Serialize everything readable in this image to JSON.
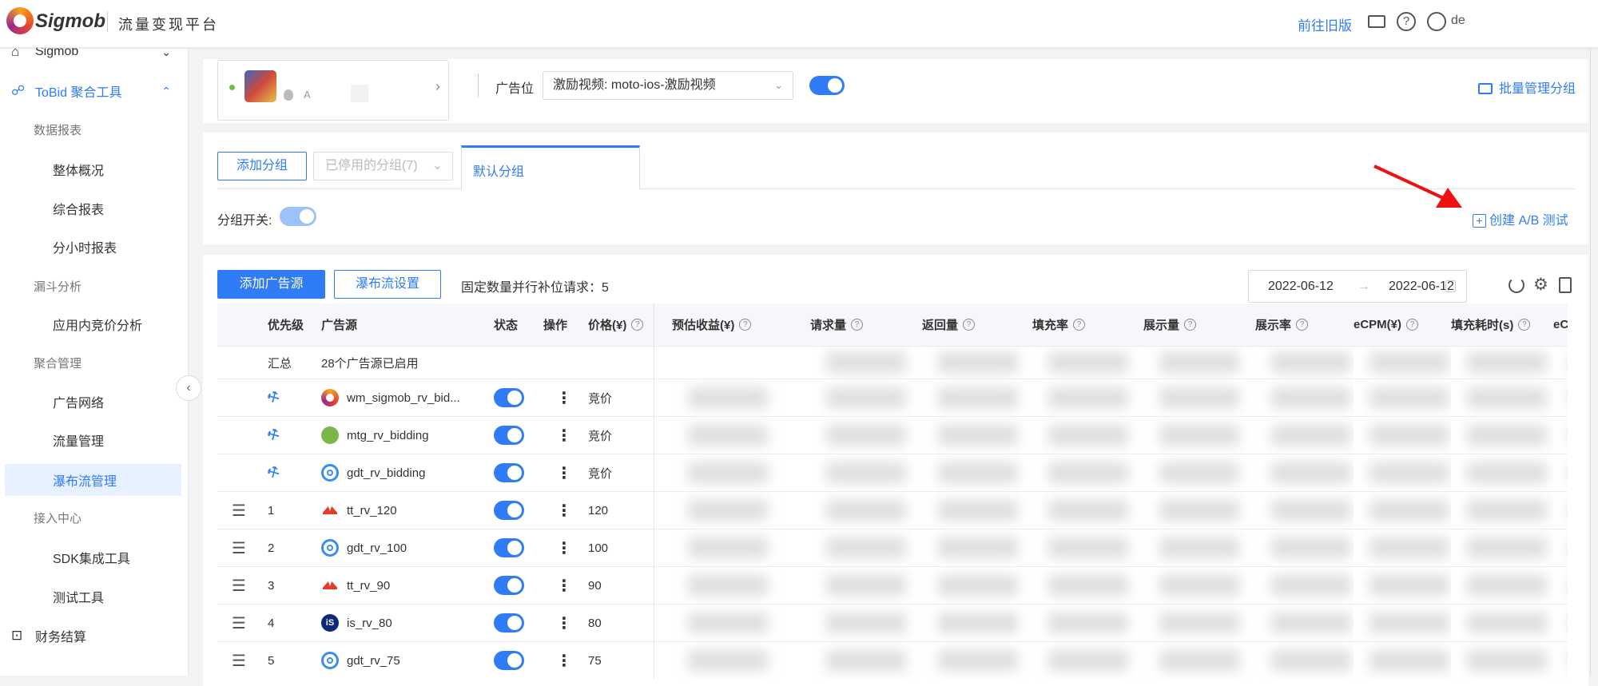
{
  "header": {
    "logo": "Sigmob",
    "platform": "流量变现平台",
    "old_version": "前往旧版",
    "user": "de"
  },
  "sidebar": {
    "items": [
      {
        "label": "Sigmob",
        "type": "l1"
      },
      {
        "label": "ToBid 聚合工具",
        "type": "l1"
      },
      {
        "label": "数据报表",
        "type": "grp"
      },
      {
        "label": "整体概况",
        "type": "l3"
      },
      {
        "label": "综合报表",
        "type": "l3"
      },
      {
        "label": "分小时报表",
        "type": "l3"
      },
      {
        "label": "漏斗分析",
        "type": "grp"
      },
      {
        "label": "应用内竞价分析",
        "type": "l3"
      },
      {
        "label": "聚合管理",
        "type": "grp"
      },
      {
        "label": "广告网络",
        "type": "l3"
      },
      {
        "label": "流量管理",
        "type": "l3"
      },
      {
        "label": "瀑布流管理",
        "type": "l3",
        "selected": true
      },
      {
        "label": "接入中心",
        "type": "grp"
      },
      {
        "label": "SDK集成工具",
        "type": "l3"
      },
      {
        "label": "测试工具",
        "type": "l3"
      },
      {
        "label": "财务结算",
        "type": "l1"
      }
    ]
  },
  "top": {
    "app_platform": "A",
    "placement_label": "广告位",
    "placement_value": "激励视频: moto-ios-激励视频",
    "placement_enabled": true,
    "batch_manage": "批量管理分组"
  },
  "groups": {
    "add_group": "添加分组",
    "disabled_groups": "已停用的分组(7)",
    "tabs": [
      {
        "label": "默认分组",
        "active": true
      }
    ],
    "switch_label": "分组开关:",
    "switch_on": true,
    "create_ab": "创建 A/B 测试"
  },
  "waterfall": {
    "add_source": "添加广告源",
    "settings": "瀑布流设置",
    "parallel_text": "固定数量并行补位请求：5",
    "date_start": "2022-06-12",
    "date_end": "2022-06-12",
    "date_arrow": "→"
  },
  "table": {
    "columns": [
      "",
      "优先级",
      "广告源",
      "状态",
      "操作",
      "价格(¥)",
      "预估收益(¥)",
      "请求量",
      "返回量",
      "填充率",
      "展示量",
      "展示率",
      "eCPM(¥)",
      "填充耗时(s)",
      "eCP"
    ],
    "summary": {
      "label": "汇总",
      "text": "28个广告源已启用"
    },
    "rows": [
      {
        "priority": "",
        "bidding": true,
        "icon": "sigmob",
        "source": "wm_sigmob_rv_bid...",
        "enabled": true,
        "price": "竞价"
      },
      {
        "priority": "",
        "bidding": true,
        "icon": "mtg",
        "source": "mtg_rv_bidding",
        "enabled": true,
        "price": "竞价"
      },
      {
        "priority": "",
        "bidding": true,
        "icon": "gdt",
        "source": "gdt_rv_bidding",
        "enabled": true,
        "price": "竞价"
      },
      {
        "priority": "1",
        "bidding": false,
        "icon": "tt",
        "source": "tt_rv_120",
        "enabled": true,
        "price": "120"
      },
      {
        "priority": "2",
        "bidding": false,
        "icon": "gdt",
        "source": "gdt_rv_100",
        "enabled": true,
        "price": "100"
      },
      {
        "priority": "3",
        "bidding": false,
        "icon": "tt",
        "source": "tt_rv_90",
        "enabled": true,
        "price": "90"
      },
      {
        "priority": "4",
        "bidding": false,
        "icon": "is",
        "source": "is_rv_80",
        "enabled": true,
        "price": "80"
      },
      {
        "priority": "5",
        "bidding": false,
        "icon": "gdt",
        "source": "gdt_rv_75",
        "enabled": true,
        "price": "75"
      }
    ]
  },
  "colors": {
    "accent": "#2f7cf6",
    "arrow": "#ee1111"
  }
}
